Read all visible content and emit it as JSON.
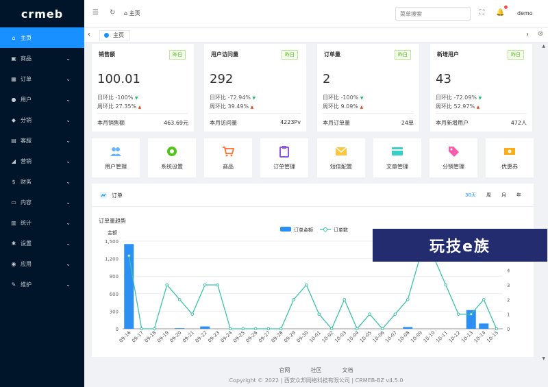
{
  "app": {
    "logo_text": "crmeb"
  },
  "sidebar": {
    "items": [
      {
        "label": "主页",
        "icon": "home-icon",
        "glyph": "⌂",
        "active": true
      },
      {
        "label": "商品",
        "icon": "shop-icon",
        "glyph": "▣"
      },
      {
        "label": "订单",
        "icon": "cart-icon",
        "glyph": "▦"
      },
      {
        "label": "用户",
        "icon": "user-icon",
        "glyph": "●"
      },
      {
        "label": "分销",
        "icon": "distribution-icon",
        "glyph": "◆"
      },
      {
        "label": "客服",
        "icon": "service-icon",
        "glyph": "▤"
      },
      {
        "label": "营销",
        "icon": "marketing-icon",
        "glyph": "◢"
      },
      {
        "label": "财务",
        "icon": "finance-icon",
        "glyph": "$"
      },
      {
        "label": "内容",
        "icon": "content-icon",
        "glyph": "▭"
      },
      {
        "label": "统计",
        "icon": "statistics-icon",
        "glyph": "▥"
      },
      {
        "label": "设置",
        "icon": "settings-icon",
        "glyph": "✱"
      },
      {
        "label": "应用",
        "icon": "app-icon",
        "glyph": "◉"
      },
      {
        "label": "维护",
        "icon": "maintain-icon",
        "glyph": "✎"
      }
    ]
  },
  "header": {
    "breadcrumb": "主页",
    "search_placeholder": "菜单搜索",
    "user": "demo"
  },
  "tabs": [
    {
      "label": "主页"
    }
  ],
  "stats": [
    {
      "title": "销售额",
      "badge": "昨日",
      "value": "100.01",
      "day_label": "日环比",
      "day_value": "-100%",
      "day_dir": "down",
      "week_label": "周环比",
      "week_value": "27.35%",
      "week_dir": "up",
      "foot_label": "本月销售额",
      "foot_value": "463.69元"
    },
    {
      "title": "用户访问量",
      "badge": "昨日",
      "value": "292",
      "day_label": "日环比",
      "day_value": "-72.94%",
      "day_dir": "down",
      "week_label": "周环比",
      "week_value": "39.49%",
      "week_dir": "up",
      "foot_label": "本月访问量",
      "foot_value": "4223Pv"
    },
    {
      "title": "订单量",
      "badge": "昨日",
      "value": "2",
      "day_label": "日环比",
      "day_value": "-100%",
      "day_dir": "down",
      "week_label": "周环比",
      "week_value": "9.09%",
      "week_dir": "up",
      "foot_label": "本月订单量",
      "foot_value": "24单"
    },
    {
      "title": "新增用户",
      "badge": "昨日",
      "value": "43",
      "day_label": "日环比",
      "day_value": "-72.09%",
      "day_dir": "down",
      "week_label": "周环比",
      "week_value": "52.97%",
      "week_dir": "up",
      "foot_label": "本月新增用户",
      "foot_value": "472人"
    }
  ],
  "quicknav": [
    {
      "label": "用户管理",
      "icon": "users-icon",
      "color": "#69b3ff"
    },
    {
      "label": "系统设置",
      "icon": "gear-icon",
      "color": "#52c41a"
    },
    {
      "label": "商品",
      "icon": "cart-icon",
      "color": "#ff7a45"
    },
    {
      "label": "订单管理",
      "icon": "clipboard-icon",
      "color": "#9254de"
    },
    {
      "label": "短信配置",
      "icon": "mail-icon",
      "color": "#ffc53d"
    },
    {
      "label": "文章管理",
      "icon": "card-icon",
      "color": "#36cfc9"
    },
    {
      "label": "分销管理",
      "icon": "tag-icon",
      "color": "#f759ab"
    },
    {
      "label": "优惠券",
      "icon": "ticket-icon",
      "color": "#faad14"
    }
  ],
  "order_panel": {
    "title": "订单",
    "ranges": [
      "30天",
      "周",
      "月",
      "年"
    ],
    "active_range": "30天",
    "chart_title": "订单量趋势"
  },
  "footer": {
    "links": [
      "官网",
      "社区",
      "文档"
    ],
    "copyright": "Copyright © 2022 | 西安众邦网络科技有限公司 | CRMEB-BZ v4.5.0"
  },
  "watermark": "玩技e族",
  "colors": {
    "sidebar_bg": "#001529",
    "accent": "#1890ff",
    "line": "#3bc2a7"
  },
  "chart_data": {
    "type": "bar",
    "title": "订单量趋势",
    "categories": [
      "09-16",
      "09-17",
      "09-18",
      "09-19",
      "09-20",
      "09-21",
      "09-22",
      "09-23",
      "09-24",
      "09-25",
      "09-26",
      "09-27",
      "09-28",
      "09-29",
      "09-30",
      "10-01",
      "10-02",
      "10-03",
      "10-04",
      "10-05",
      "10-06",
      "10-07",
      "10-08",
      "10-09",
      "10-10",
      "10-11",
      "10-12",
      "10-13",
      "10-14",
      "10-15"
    ],
    "series": [
      {
        "name": "订单金额",
        "type": "bar",
        "axis": "left",
        "values": [
          1450,
          0,
          0,
          0,
          10,
          0,
          40,
          0,
          0,
          0,
          0,
          0,
          0,
          0,
          0,
          0,
          0,
          0,
          0,
          0,
          0,
          0,
          30,
          0,
          0,
          0,
          0,
          320,
          90,
          0
        ]
      },
      {
        "name": "订单数",
        "type": "line",
        "axis": "right",
        "values": [
          5,
          0,
          0,
          3,
          2,
          1,
          3,
          3,
          0,
          0,
          0,
          0,
          0,
          2,
          3,
          1,
          0,
          2,
          0,
          1,
          0,
          1,
          2,
          5,
          5,
          3,
          1,
          1,
          2,
          0
        ]
      }
    ],
    "ylabel": "金额",
    "ylim": [
      0,
      1500
    ],
    "yticks": [
      0,
      300,
      600,
      900,
      1200,
      1500
    ],
    "y2lim": [
      0,
      6
    ],
    "y2ticks": [
      0,
      1,
      2,
      3,
      4,
      5
    ],
    "legend": "top-center",
    "grid": true
  }
}
